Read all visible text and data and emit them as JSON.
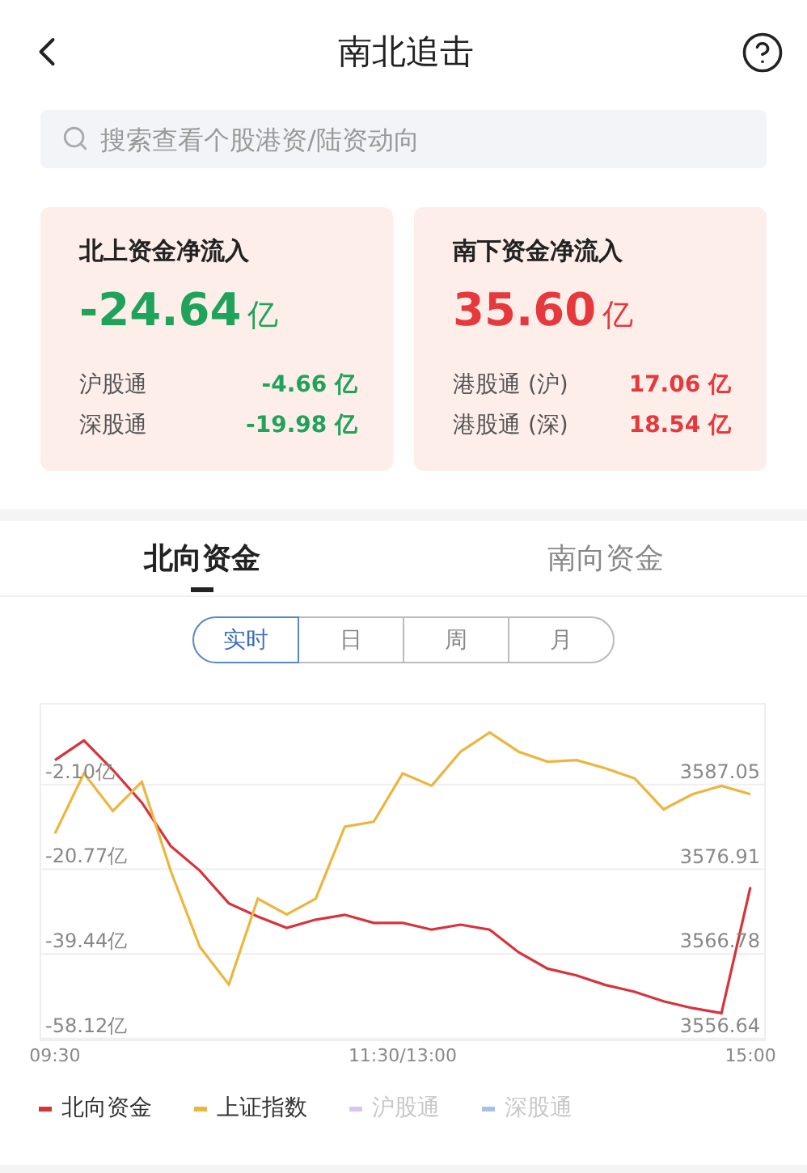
{
  "header": {
    "title": "南北追击"
  },
  "search": {
    "placeholder": "搜索查看个股港资/陆资动向"
  },
  "cards": [
    {
      "title": "北上资金净流入",
      "value": "-24.64",
      "unit": "亿",
      "color": "#1fa35a",
      "rows": [
        {
          "label": "沪股通",
          "value": "-4.66 亿",
          "color": "#1fa35a"
        },
        {
          "label": "深股通",
          "value": "-19.98 亿",
          "color": "#1fa35a"
        }
      ]
    },
    {
      "title": "南下资金净流入",
      "value": "35.60",
      "unit": "亿",
      "color": "#e5393d",
      "rows": [
        {
          "label": "港股通 (沪)",
          "value": "17.06 亿",
          "color": "#e5393d"
        },
        {
          "label": "港股通 (深)",
          "value": "18.54 亿",
          "color": "#e5393d"
        }
      ]
    }
  ],
  "tabs": [
    {
      "label": "北向资金",
      "selected": true
    },
    {
      "label": "南向资金",
      "selected": false
    }
  ],
  "periods": [
    {
      "label": "实时",
      "selected": true
    },
    {
      "label": "日",
      "selected": false
    },
    {
      "label": "周",
      "selected": false
    },
    {
      "label": "月",
      "selected": false
    }
  ],
  "chart_data": {
    "type": "line",
    "categories": [
      "09:30",
      null,
      null,
      null,
      null,
      null,
      null,
      null,
      null,
      null,
      null,
      null,
      "11:30/13:00",
      null,
      null,
      null,
      null,
      null,
      null,
      null,
      null,
      null,
      null,
      null,
      "15:00"
    ],
    "grid": true,
    "ylim": [
      -58.5,
      15.7
    ],
    "yticks": [
      {
        "value": -2.1,
        "label": "-2.10亿"
      },
      {
        "value": -20.77,
        "label": "-20.77亿"
      },
      {
        "value": -39.44,
        "label": "-39.44亿"
      },
      {
        "value": -58.12,
        "label": "-58.12亿"
      }
    ],
    "y2lim": [
      3556.41,
      3596.74
    ],
    "y2ticks": [
      {
        "value": 3587.05,
        "label": "3587.05"
      },
      {
        "value": 3576.91,
        "label": "3576.91"
      },
      {
        "value": 3566.78,
        "label": "3566.78"
      },
      {
        "value": 3556.64,
        "label": "3556.64"
      }
    ],
    "series": [
      {
        "color": "#d8333b",
        "axis": "y",
        "values": [
          3.3,
          7.6,
          1.1,
          -6.1,
          -15.7,
          -21.1,
          -28.3,
          -31.2,
          -33.7,
          -31.9,
          -30.8,
          -32.6,
          -32.6,
          -34.1,
          -33.0,
          -34.1,
          -39.1,
          -42.7,
          -44.2,
          -46.3,
          -47.8,
          -49.9,
          -51.4,
          -52.5,
          -24.7
        ]
      },
      {
        "color": "#ebb63e",
        "axis": "y2",
        "values": [
          3581.2,
          3588.4,
          3583.9,
          3587.4,
          3576.7,
          3567.6,
          3563.1,
          3573.4,
          3571.5,
          3573.4,
          3582.0,
          3582.6,
          3588.4,
          3586.9,
          3591.0,
          3593.3,
          3591.0,
          3589.8,
          3590.0,
          3589.0,
          3587.8,
          3584.1,
          3585.9,
          3586.9,
          3585.9
        ]
      }
    ]
  },
  "legend": [
    {
      "label": "北向资金",
      "color": "#d8333b",
      "on": true
    },
    {
      "label": "上证指数",
      "color": "#ebb63e",
      "on": true
    },
    {
      "label": "沪股通",
      "color": "#d9c5ee",
      "on": false
    },
    {
      "label": "深股通",
      "color": "#aabfe8",
      "on": false
    }
  ]
}
